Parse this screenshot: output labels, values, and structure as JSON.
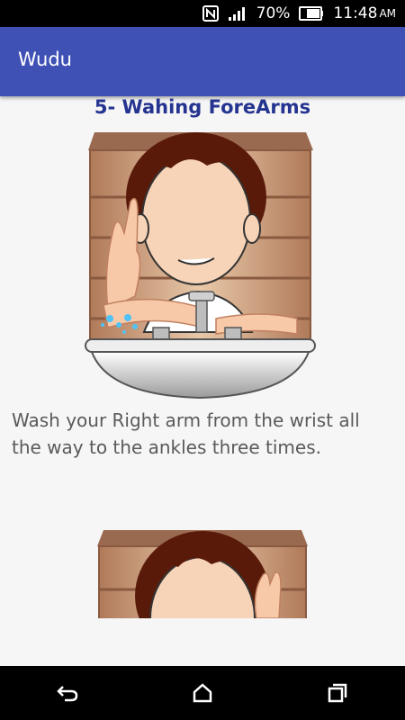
{
  "status_bar": {
    "battery": "70%",
    "time": "11:48",
    "ampm": "AM",
    "icons": [
      "nfc-icon",
      "signal-icon",
      "battery-icon"
    ]
  },
  "app_bar": {
    "title": "Wudu"
  },
  "step": {
    "title": "5- Wahing ForeArms",
    "instruction": "Wash your Right arm from the wrist all the way to the ankles three times."
  },
  "navigation": {
    "buttons": [
      "back-icon",
      "home-icon",
      "recents-icon"
    ]
  },
  "colors": {
    "app_bar": "#3f51b5",
    "title_text": "#253490",
    "body_text": "#5a5a5a"
  }
}
